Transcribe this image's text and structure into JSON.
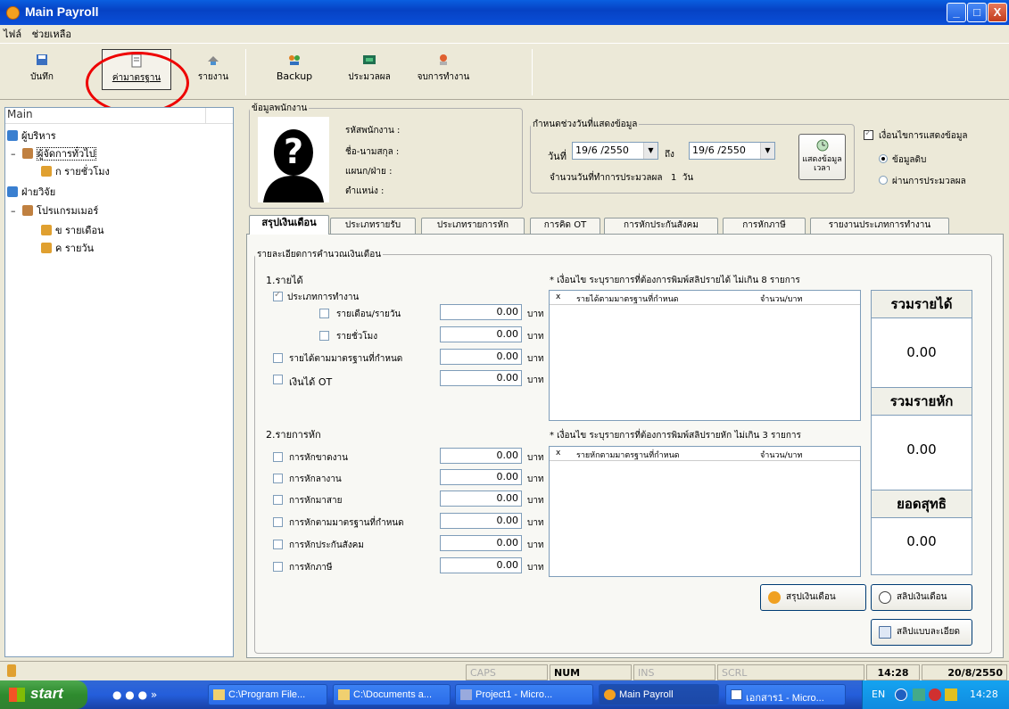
{
  "window": {
    "title": "Main Payroll"
  },
  "menu": [
    "ไฟล์",
    "ช่วยเหลือ"
  ],
  "toolbar": {
    "save": "บันทึก",
    "standard": "ค่ามาตรฐาน",
    "report": "รายงาน",
    "backup": "Backup",
    "process": "ประมวลผล",
    "attendance": "จบการทำงาน"
  },
  "tree": {
    "header": "Main",
    "items": [
      "ผู้บริหาร",
      "ผู้จัดการทั่วไป",
      "ก รายชั่วโมง",
      "ฝ่ายวิจัย",
      "โปรแกรมเมอร์",
      "ข รายเดือน",
      "ค รายวัน"
    ]
  },
  "employee": {
    "group": "ข้อมูลพนักงาน",
    "id_label": "รหัสพนักงาน :",
    "name_label": "ชื่อ-นามสกุล :",
    "dept_label": "แผนก/ฝ่าย :",
    "position_label": "ตำแหน่ง :"
  },
  "period": {
    "group": "กำหนดช่วงวันที่แสดงข้อมูล",
    "from_label": "วันที่",
    "from_value": "19/6 /2550",
    "to_label": "ถึง",
    "to_value": "19/6 /2550",
    "days_label": "จำนวนวันที่ทำการประมวลผล",
    "days_value": "1",
    "days_unit": "วัน",
    "show_btn": "แสดงข้อมูลเวลา"
  },
  "condition": {
    "label": "เงื่อนไขการแสดงข้อมูล",
    "raw": "ข้อมูลดิบ",
    "processed": "ผ่านการประมวลผล"
  },
  "tabs": [
    "สรุปเงินเดือน",
    "ประเภทรายรับ",
    "ประเภทรายการหัก",
    "การคิด OT",
    "การหักประกันสังคม",
    "การหักภาษี",
    "รายงานประเภทการทำงาน"
  ],
  "salary": {
    "group": "รายละเอียดการคำนวณเงินเดือน",
    "income_title": "1.รายได้",
    "work_type": "ประเภทการทำงาน",
    "monthly_daily": "รายเดือน/รายวัน",
    "hourly": "รายชั่วโมง",
    "standard_income": "รายได้ตามมาตรฐานที่กำหนด",
    "ot_income": "เงินได้ OT",
    "deduct_title": "2.รายการหัก",
    "absent": "การหักขาดงาน",
    "leave": "การหักลางาน",
    "late": "การหักมาสาย",
    "standard_deduct": "การหักตามมาตรฐานที่กำหนด",
    "social": "การหักประกันสังคม",
    "tax": "การหักภาษี",
    "amount": "0.00",
    "unit": "บาท",
    "income_note": "* เงื่อนไข  ระบุรายการที่ต้องการพิมพ์สลิปรายได้  ไม่เกิน 8 รายการ",
    "income_col_x": "x",
    "income_col_name": "รายได้ตามมาตรฐานที่กำหนด",
    "income_col_amt": "จำนวน/บาท",
    "deduct_note": "* เงื่อนไข  ระบุรายการที่ต้องการพิมพ์สลิปรายหัก  ไม่เกิน 3 รายการ",
    "deduct_col_x": "x",
    "deduct_col_name": "รายหักตามมาตรฐานที่กำหนด",
    "deduct_col_amt": "จำนวน/บาท"
  },
  "summary": {
    "total_income": "รวมรายได้",
    "total_income_val": "0.00",
    "total_deduct": "รวมรายหัก",
    "total_deduct_val": "0.00",
    "net": "ยอดสุทธิ",
    "net_val": "0.00"
  },
  "buttons": {
    "summarize": "สรุปเงินเดือน",
    "slip": "สลิปเงินเดือน",
    "detail_slip": "สลิปแบบละเอียด"
  },
  "status": {
    "caps": "CAPS",
    "num": "NUM",
    "ins": "INS",
    "scrl": "SCRL",
    "time": "14:28",
    "date": "20/8/2550"
  },
  "taskbar": {
    "start": "start",
    "tasks": [
      "C:\\Program File...",
      "C:\\Documents a...",
      "Project1 - Micro...",
      "Main Payroll",
      "เอกสาร1 - Micro..."
    ],
    "lang": "EN",
    "clock": "14:28"
  },
  "colors": {
    "title": "#0a4fd8",
    "highlight_circle": "#e00000"
  }
}
